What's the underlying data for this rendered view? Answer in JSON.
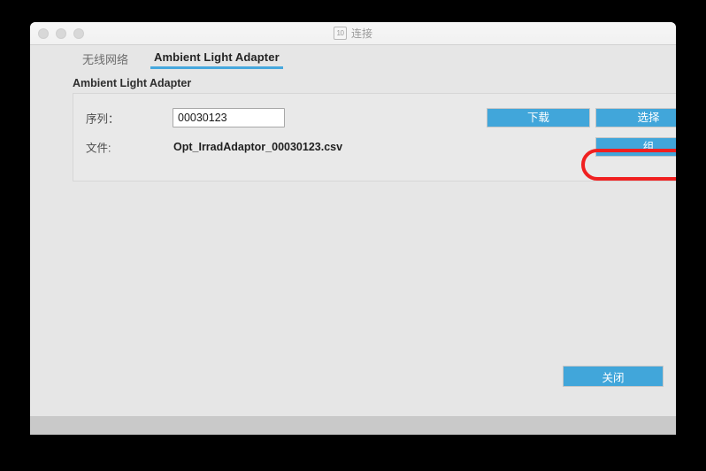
{
  "window": {
    "title": "连接",
    "title_icon": "app-window-icon",
    "traffic_lights": [
      "close",
      "minimize",
      "zoom"
    ]
  },
  "tabs": [
    {
      "label": "无线网络",
      "active": false
    },
    {
      "label": "Ambient Light Adapter",
      "active": true
    }
  ],
  "group": {
    "title": "Ambient Light Adapter"
  },
  "form": {
    "serial": {
      "label": "序列：",
      "value": "00030123",
      "placeholder": ""
    },
    "file": {
      "label": "文件:",
      "value": "Opt_IrradAdaptor_00030123.csv"
    }
  },
  "buttons": {
    "download": "下载",
    "select": "选择",
    "group": "组",
    "close": "关闭"
  },
  "colors": {
    "accent": "#41a6da",
    "highlight": "#f02020",
    "window_bg": "#e6e6e6",
    "panel_bg": "#e9e9e9",
    "titlebar_bg": "#f4f4f4",
    "bottombar_bg": "#c9c9c9",
    "tab_underline": "#46a8dd"
  }
}
